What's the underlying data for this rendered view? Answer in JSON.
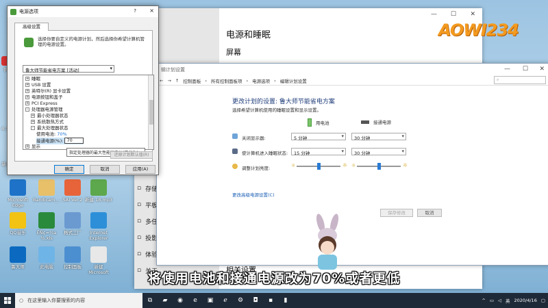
{
  "desktop": {
    "icons": [
      {
        "label": "Microsoft Edge",
        "color": "#1e73c8"
      },
      {
        "label": "Bandicam_...",
        "color": "#e8c06a"
      },
      {
        "label": "SAI Ver.2",
        "color": "#e7643a"
      },
      {
        "label": "新建 18.mp3",
        "color": "#5da84c"
      },
      {
        "label": "QQ音乐",
        "color": "#f2c312"
      },
      {
        "label": "ÊÑ¢=¼a ½.xls",
        "color": "#2a8a3b"
      },
      {
        "label": "格式工厂",
        "color": "#6a9ad0"
      },
      {
        "label": "Internet Explorer",
        "color": "#2d8fd8"
      },
      {
        "label": "鲁大师",
        "color": "#0b6ac0"
      },
      {
        "label": "此电脑",
        "color": "#6fb4e6"
      },
      {
        "label": "控制面板",
        "color": "#4c8fd0"
      },
      {
        "label": "新建 Microsoft",
        "color": "#e8e8e8"
      }
    ],
    "left_labels": [
      "阿",
      "4.15",
      "新建"
    ]
  },
  "settings_window": {
    "title": "电源和睡眠",
    "subtitle": "屏幕",
    "bottom_section": "相关设置",
    "nav_items": [
      {
        "icon": "storage-icon",
        "label": "存储"
      },
      {
        "icon": "tablet-icon",
        "label": "平板模"
      },
      {
        "icon": "multitask-icon",
        "label": "多任务"
      },
      {
        "icon": "project-icon",
        "label": "投影到"
      },
      {
        "icon": "experience-icon",
        "label": "体验共"
      },
      {
        "icon": "about-icon",
        "label": "关于"
      }
    ]
  },
  "edit_plan": {
    "window_title": "辑计划设置",
    "address": [
      "控制面板",
      "所有控制面板项",
      "电源选项",
      "编辑计划设置"
    ],
    "search_placeholder": "",
    "heading": "更改计划的设置: 鲁大师节能省电方案",
    "description": "选择希望计算机使用的睡眠设置和显示设置。",
    "col_battery": "用电池",
    "col_plugged": "接通电源",
    "rows": [
      {
        "label": "关闭显示器:",
        "battery": "5 分钟",
        "plugged": "30 分钟"
      },
      {
        "label": "使计算机进入睡眠状态:",
        "battery": "15 分钟",
        "plugged": "30 分钟"
      }
    ],
    "brightness_label": "调整计划亮度:",
    "brightness_battery": 0.5,
    "brightness_plugged": 0.5,
    "restore_link": "更改高级电源设置(C)",
    "save_button": "保存修改",
    "cancel_button": "取消"
  },
  "dialog": {
    "title": "电源选项",
    "help": "?",
    "close": "×",
    "tab": "高级设置",
    "info": "选择你要自定义的电源计划，然后选择你希望计算机管理的电源设置。",
    "plan": "鲁大师节能省电方案 [活动]",
    "tree": [
      {
        "indent": 0,
        "pm": "+",
        "label": "睡眠"
      },
      {
        "indent": 0,
        "pm": "+",
        "label": "USB 设置"
      },
      {
        "indent": 0,
        "pm": "+",
        "label": "英特尔(R) 显卡设置"
      },
      {
        "indent": 0,
        "pm": "+",
        "label": "电源按钮和盖子"
      },
      {
        "indent": 0,
        "pm": "+",
        "label": "PCI Express"
      },
      {
        "indent": 0,
        "pm": "-",
        "label": "处理器电源管理"
      },
      {
        "indent": 1,
        "pm": "+",
        "label": "最小处理器状态"
      },
      {
        "indent": 1,
        "pm": "+",
        "label": "系统散热方式"
      },
      {
        "indent": 1,
        "pm": "-",
        "label": "最大处理器状态"
      },
      {
        "indent": 2,
        "pm": "",
        "label": "使用电池:",
        "value": "70%"
      },
      {
        "indent": 2,
        "pm": "",
        "label": "接通电源(%):",
        "input": "70",
        "selected": true
      },
      {
        "indent": 0,
        "pm": "+",
        "label": "显示"
      }
    ],
    "tooltip": "指定处理器的最大性能状态(以百分比)。",
    "restore_button": "还原计划默认值(R)",
    "ok": "确定",
    "cancel": "取消",
    "apply": "应用(A)"
  },
  "subtitle": "将使用电池和接通电源改为70%或者更低",
  "logo": "AOWI234",
  "taskbar": {
    "search_placeholder": "在这里输入你要搜索的内容",
    "apps": [
      "task-view-icon",
      "folder-icon",
      "penguin-icon",
      "edge-icon",
      "store-icon",
      "ie-icon",
      "settings-icon",
      "camera-icon",
      "app-icon",
      "power-icon"
    ],
    "time": "",
    "date": "2020/4/16"
  }
}
